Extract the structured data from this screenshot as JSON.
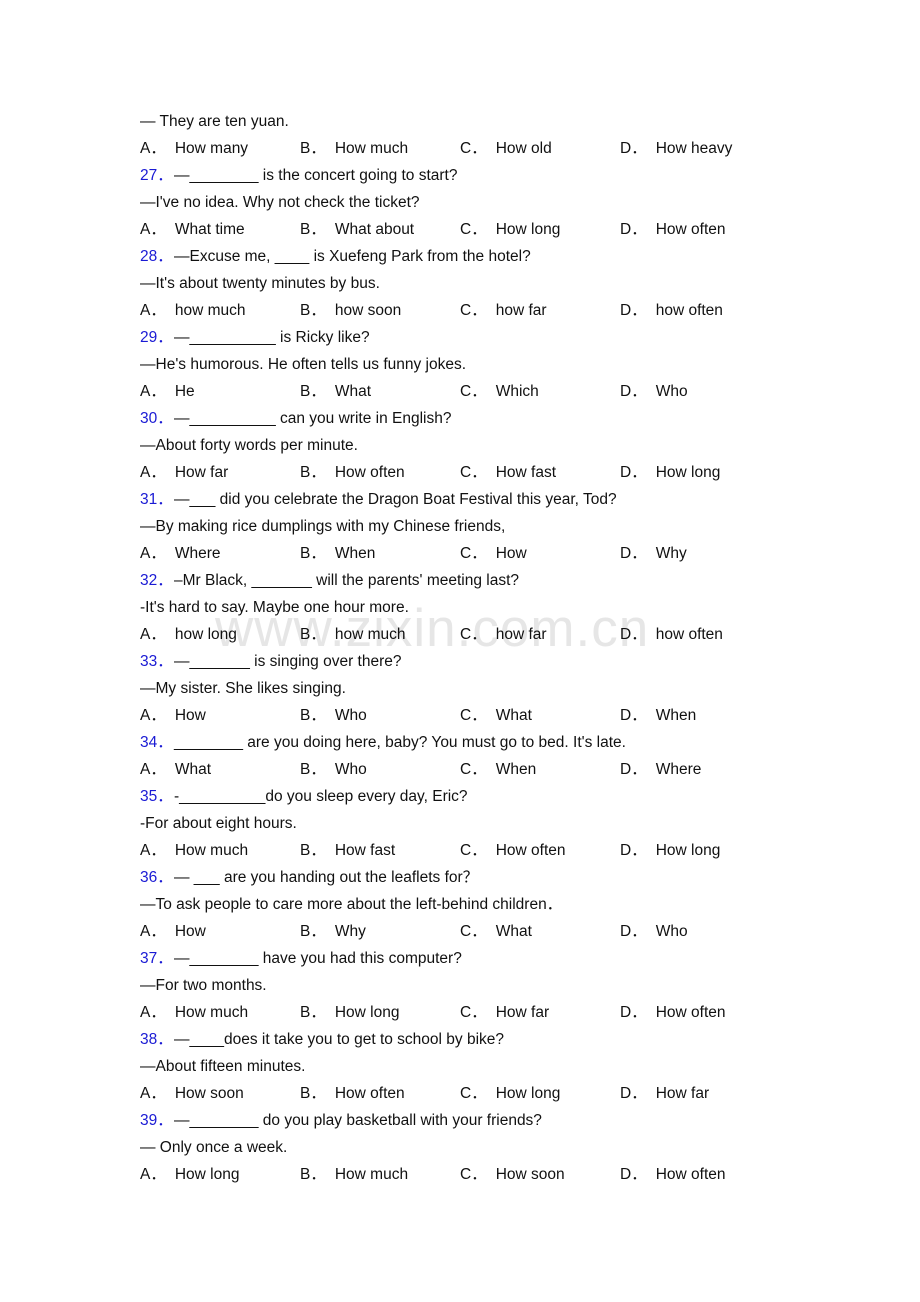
{
  "watermark": {
    "text": "www.zixin.com.cn"
  },
  "colors": {
    "question_number": "#1a1ad4",
    "body_text": "#111111",
    "watermark": "#e6e6e6",
    "page_background": "#ffffff"
  },
  "document": {
    "type": "english-multiple-choice-worksheet",
    "option_labels": [
      "A．",
      "B．",
      "C．",
      "D．"
    ],
    "lead_line": "— They are ten yuan.",
    "lead_options": [
      "How many",
      "How much",
      "How old",
      "How heavy"
    ],
    "questions": [
      {
        "number": "27．",
        "stem": "—________ is the concert going to start?",
        "reply": "—I've no idea. Why not check the ticket?",
        "options": [
          "What time",
          "What about",
          "How long",
          "How often"
        ]
      },
      {
        "number": "28．",
        "stem": "—Excuse me, ____ is Xuefeng Park from the hotel?",
        "reply": "—It's about twenty minutes by bus.",
        "options": [
          "how much",
          "how soon",
          "how far",
          "how often"
        ]
      },
      {
        "number": "29．",
        "stem": "—__________ is Ricky like?",
        "reply": "—He's humorous. He often tells us funny jokes.",
        "options": [
          "He",
          "What",
          "Which",
          "Who"
        ]
      },
      {
        "number": "30．",
        "stem": "—__________ can you write in English?",
        "reply": "—About forty words per minute.",
        "options": [
          "How far",
          "How often",
          "How fast",
          "How long"
        ]
      },
      {
        "number": "31．",
        "stem": "—___ did you celebrate the Dragon Boat Festival this year, Tod?",
        "reply": "—By making rice dumplings with my Chinese friends,",
        "options": [
          "Where",
          "When",
          "How",
          "Why"
        ]
      },
      {
        "number": "32．",
        "stem": "–Mr Black, _______ will the parents' meeting last?",
        "reply": "-It's hard to say. Maybe one hour more.",
        "options": [
          "how long",
          "how much",
          "how far",
          "how often"
        ]
      },
      {
        "number": "33．",
        "stem": "—_______ is singing over there?",
        "reply": "—My sister. She likes singing.",
        "options": [
          "How",
          "Who",
          "What",
          "When"
        ]
      },
      {
        "number": "34．",
        "stem": "________ are you doing here, baby? You must go to bed. It's late.",
        "reply": "",
        "options": [
          "What",
          "Who",
          "When",
          "Where"
        ]
      },
      {
        "number": "35．",
        "stem": "-__________do you sleep every day, Eric?",
        "reply": "-For about eight hours.",
        "options": [
          "How much",
          "How fast",
          "How often",
          "How long"
        ]
      },
      {
        "number": "36．",
        "stem": "— ___ are you handing out the leaflets for？",
        "reply": "—To ask people to care more about the left-behind children．",
        "options": [
          "How",
          "Why",
          "What",
          "Who"
        ]
      },
      {
        "number": "37．",
        "stem": "—________ have you had this computer?",
        "reply": "—For two months.",
        "options": [
          "How much",
          "How long",
          "How far",
          "How often"
        ]
      },
      {
        "number": "38．",
        "stem": "—____does it take you to get to school by bike?",
        "reply": "—About fifteen minutes.",
        "options": [
          "How soon",
          "How often",
          "How long",
          "How far"
        ]
      },
      {
        "number": "39．",
        "stem": "—________ do you play basketball with your friends?",
        "reply": "— Only once a week.",
        "options": [
          "How long",
          "How much",
          "How soon",
          "How often"
        ]
      }
    ]
  }
}
